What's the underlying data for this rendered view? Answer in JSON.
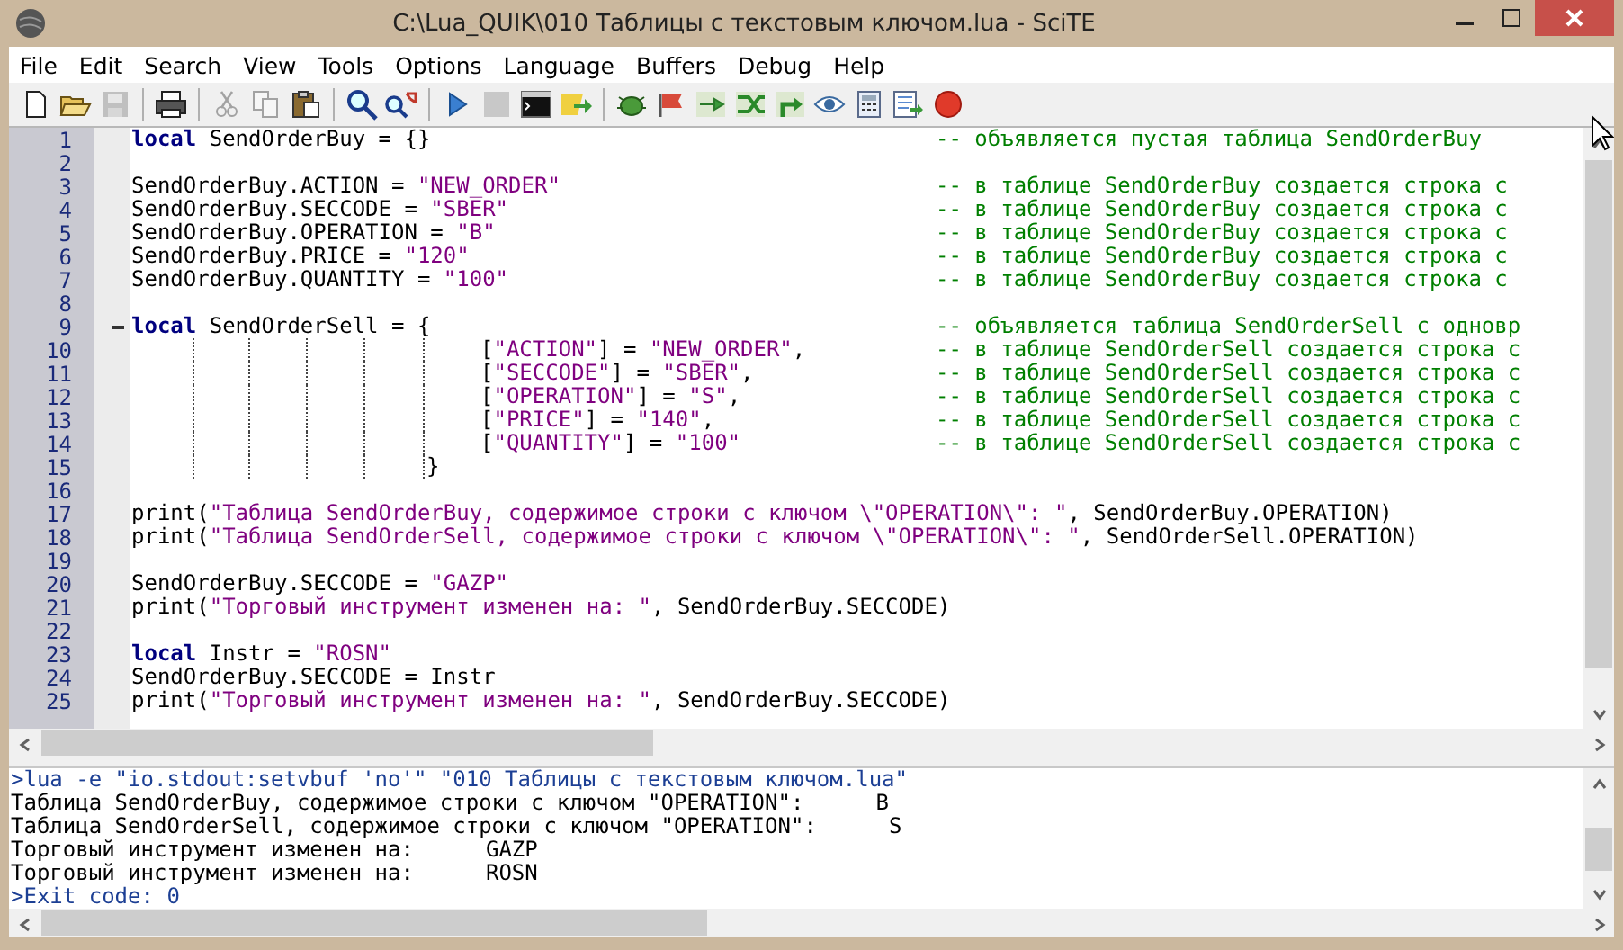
{
  "window": {
    "title": "C:\\Lua_QUIK\\010 Таблицы с текстовым ключом.lua - SciTE"
  },
  "menu": [
    "File",
    "Edit",
    "Search",
    "View",
    "Tools",
    "Options",
    "Language",
    "Buffers",
    "Debug",
    "Help"
  ],
  "toolbar": [
    {
      "buttons": [
        {
          "kind": "new",
          "disabled": false
        },
        {
          "kind": "open",
          "disabled": false
        },
        {
          "kind": "save",
          "disabled": true
        }
      ]
    },
    {
      "buttons": [
        {
          "kind": "print",
          "disabled": false
        }
      ]
    },
    {
      "buttons": [
        {
          "kind": "cut",
          "disabled": true
        },
        {
          "kind": "copy",
          "disabled": true
        },
        {
          "kind": "paste",
          "disabled": false
        }
      ]
    },
    {
      "buttons": [
        {
          "kind": "find",
          "disabled": false
        },
        {
          "kind": "replace",
          "disabled": false
        }
      ]
    },
    {
      "buttons": [
        {
          "kind": "run",
          "disabled": false
        },
        {
          "kind": "stop",
          "disabled": true
        },
        {
          "kind": "terminal",
          "disabled": false
        },
        {
          "kind": "compile",
          "disabled": false
        }
      ]
    },
    {
      "buttons": [
        {
          "kind": "bug",
          "disabled": false
        },
        {
          "kind": "flag",
          "disabled": false
        },
        {
          "kind": "step",
          "disabled": false
        },
        {
          "kind": "swap",
          "disabled": false
        },
        {
          "kind": "turn",
          "disabled": false
        },
        {
          "kind": "eye",
          "disabled": false
        },
        {
          "kind": "calculator",
          "disabled": false
        },
        {
          "kind": "document",
          "disabled": false
        },
        {
          "kind": "record",
          "disabled": false
        }
      ]
    }
  ],
  "editor": {
    "lines": [
      {
        "number": "1",
        "kind": "top",
        "fold": false,
        "code": [
          {
            "kind": "keyword",
            "text": "local"
          },
          {
            "kind": "plain",
            "text": " SendOrderBuy = {}"
          }
        ],
        "comment": "-- объявляется пустая таблица SendOrderBuy"
      },
      {
        "number": "2",
        "kind": "top",
        "fold": false
      },
      {
        "number": "3",
        "kind": "top",
        "fold": false,
        "code": [
          {
            "kind": "plain",
            "text": "SendOrderBuy.ACTION = "
          },
          {
            "kind": "string",
            "text": "\"NEW_ORDER\""
          }
        ],
        "comment": "-- в таблице SendOrderBuy создается строка с"
      },
      {
        "number": "4",
        "kind": "top",
        "fold": false,
        "code": [
          {
            "kind": "plain",
            "text": "SendOrderBuy.SECCODE = "
          },
          {
            "kind": "string",
            "text": "\"SBER\""
          }
        ],
        "comment": "-- в таблице SendOrderBuy создается строка с"
      },
      {
        "number": "5",
        "kind": "top",
        "fold": false,
        "code": [
          {
            "kind": "plain",
            "text": "SendOrderBuy.OPERATION = "
          },
          {
            "kind": "string",
            "text": "\"B\""
          }
        ],
        "comment": "-- в таблице SendOrderBuy создается строка с"
      },
      {
        "number": "6",
        "kind": "top",
        "fold": false,
        "code": [
          {
            "kind": "plain",
            "text": "SendOrderBuy.PRICE = "
          },
          {
            "kind": "string",
            "text": "\"120\""
          }
        ],
        "comment": "-- в таблице SendOrderBuy создается строка с"
      },
      {
        "number": "7",
        "kind": "top",
        "fold": false,
        "code": [
          {
            "kind": "plain",
            "text": "SendOrderBuy.QUANTITY = "
          },
          {
            "kind": "string",
            "text": "\"100\""
          }
        ],
        "comment": "-- в таблице SendOrderBuy создается строка с"
      },
      {
        "number": "8",
        "kind": "top",
        "fold": false
      },
      {
        "number": "9",
        "kind": "top",
        "fold": true,
        "code": [
          {
            "kind": "keyword",
            "text": "local"
          },
          {
            "kind": "plain",
            "text": " SendOrderSell = {"
          }
        ],
        "comment": "-- объявляется таблица SendOrderSell с одновр"
      },
      {
        "number": "10",
        "kind": "entry",
        "fold": false,
        "code": [
          {
            "kind": "plain",
            "text": "["
          },
          {
            "kind": "string",
            "text": "\"ACTION\""
          },
          {
            "kind": "plain",
            "text": "] = "
          },
          {
            "kind": "string",
            "text": "\"NEW_ORDER\""
          },
          {
            "kind": "plain",
            "text": ","
          }
        ],
        "comment": "-- в таблице SendOrderSell создается строка с"
      },
      {
        "number": "11",
        "kind": "entry",
        "fold": false,
        "code": [
          {
            "kind": "plain",
            "text": "["
          },
          {
            "kind": "string",
            "text": "\"SECCODE\""
          },
          {
            "kind": "plain",
            "text": "] = "
          },
          {
            "kind": "string",
            "text": "\"SBER\""
          },
          {
            "kind": "plain",
            "text": ","
          }
        ],
        "comment": "-- в таблице SendOrderSell создается строка с"
      },
      {
        "number": "12",
        "kind": "entry",
        "fold": false,
        "code": [
          {
            "kind": "plain",
            "text": "["
          },
          {
            "kind": "string",
            "text": "\"OPERATION\""
          },
          {
            "kind": "plain",
            "text": "] = "
          },
          {
            "kind": "string",
            "text": "\"S\""
          },
          {
            "kind": "plain",
            "text": ","
          }
        ],
        "comment": "-- в таблице SendOrderSell создается строка с"
      },
      {
        "number": "13",
        "kind": "entry",
        "fold": false,
        "code": [
          {
            "kind": "plain",
            "text": "["
          },
          {
            "kind": "string",
            "text": "\"PRICE\""
          },
          {
            "kind": "plain",
            "text": "] = "
          },
          {
            "kind": "string",
            "text": "\"140\""
          },
          {
            "kind": "plain",
            "text": ","
          }
        ],
        "comment": "-- в таблице SendOrderSell создается строка с"
      },
      {
        "number": "14",
        "kind": "entry",
        "fold": false,
        "code": [
          {
            "kind": "plain",
            "text": "["
          },
          {
            "kind": "string",
            "text": "\"QUANTITY\""
          },
          {
            "kind": "plain",
            "text": "] = "
          },
          {
            "kind": "string",
            "text": "\"100\""
          }
        ],
        "comment": "-- в таблице SendOrderSell создается строка с"
      },
      {
        "number": "15",
        "kind": "close",
        "fold": false,
        "code": [
          {
            "kind": "plain",
            "text": "}"
          }
        ]
      },
      {
        "number": "16",
        "kind": "top",
        "fold": false
      },
      {
        "number": "17",
        "kind": "top",
        "fold": false,
        "code": [
          {
            "kind": "plain",
            "text": "print("
          },
          {
            "kind": "string",
            "text": "\"Таблица SendOrderBuy, содержимое строки с ключом \\\"OPERATION\\\": \""
          },
          {
            "kind": "plain",
            "text": ", SendOrderBuy.OPERATION)"
          }
        ]
      },
      {
        "number": "18",
        "kind": "top",
        "fold": false,
        "code": [
          {
            "kind": "plain",
            "text": "print("
          },
          {
            "kind": "string",
            "text": "\"Таблица SendOrderSell, содержимое строки с ключом \\\"OPERATION\\\": \""
          },
          {
            "kind": "plain",
            "text": ", SendOrderSell.OPERATION)"
          }
        ]
      },
      {
        "number": "19",
        "kind": "top",
        "fold": false
      },
      {
        "number": "20",
        "kind": "top",
        "fold": false,
        "code": [
          {
            "kind": "plain",
            "text": "SendOrderBuy.SECCODE = "
          },
          {
            "kind": "string",
            "text": "\"GAZP\""
          }
        ]
      },
      {
        "number": "21",
        "kind": "top",
        "fold": false,
        "code": [
          {
            "kind": "plain",
            "text": "print("
          },
          {
            "kind": "string",
            "text": "\"Торговый инструмент изменен на: \""
          },
          {
            "kind": "plain",
            "text": ", SendOrderBuy.SECCODE)"
          }
        ]
      },
      {
        "number": "22",
        "kind": "top",
        "fold": false
      },
      {
        "number": "23",
        "kind": "top",
        "fold": false,
        "code": [
          {
            "kind": "keyword",
            "text": "local"
          },
          {
            "kind": "plain",
            "text": " Instr = "
          },
          {
            "kind": "string",
            "text": "\"ROSN\""
          }
        ]
      },
      {
        "number": "24",
        "kind": "top",
        "fold": false,
        "code": [
          {
            "kind": "plain",
            "text": "SendOrderBuy.SECCODE = Instr"
          }
        ]
      },
      {
        "number": "25",
        "kind": "top",
        "fold": false,
        "code": [
          {
            "kind": "plain",
            "text": "print("
          },
          {
            "kind": "string",
            "text": "\"Торговый инструмент изменен на: \""
          },
          {
            "kind": "plain",
            "text": ", SendOrderBuy.SECCODE)"
          }
        ]
      }
    ]
  },
  "output": {
    "lines": [
      {
        "kind": "command",
        "text": ">lua -e \"io.stdout:setvbuf 'no'\" \"010 Таблицы с текстовым ключом.lua\""
      },
      {
        "kind": "plain",
        "text": "Таблица SendOrderBuy, содержимое строки с ключом \"OPERATION\":",
        "value": "B"
      },
      {
        "kind": "plain",
        "text": "Таблица SendOrderSell, содержимое строки с ключом \"OPERATION\":",
        "value": "S"
      },
      {
        "kind": "plain",
        "text": "Торговый инструмент изменен на:",
        "value": "GAZP"
      },
      {
        "kind": "plain",
        "text": "Торговый инструмент изменен на:",
        "value": "ROSN"
      },
      {
        "kind": "command",
        "text": ">Exit code: 0"
      }
    ]
  }
}
